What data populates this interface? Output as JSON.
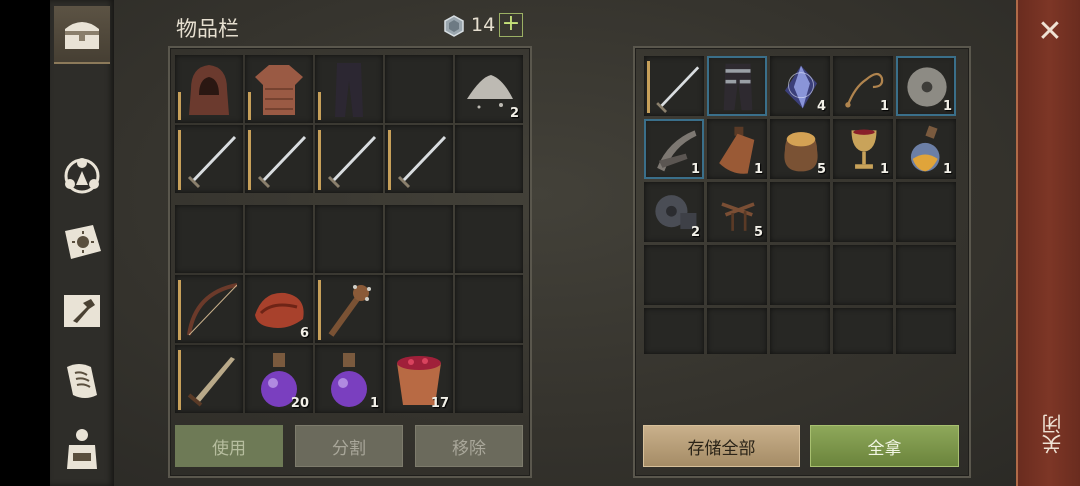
{
  "header": {
    "title": "物品栏",
    "currency_icon": "gem-icon",
    "currency_count": "14",
    "add_currency": "+"
  },
  "inventory": {
    "equipped": [
      {
        "icon": "hood-icon"
      },
      {
        "icon": "tunic-icon"
      },
      {
        "icon": "pants-icon"
      },
      {
        "icon": ""
      },
      {
        "icon": "ash-pile-icon",
        "qty": "2"
      },
      {
        "icon": "sword-icon"
      },
      {
        "icon": "sword-icon"
      },
      {
        "icon": "sword-icon"
      },
      {
        "icon": "sword-icon"
      },
      {
        "icon": ""
      }
    ],
    "bag": [
      {
        "icon": ""
      },
      {
        "icon": ""
      },
      {
        "icon": ""
      },
      {
        "icon": ""
      },
      {
        "icon": ""
      },
      {
        "icon": "bow-icon"
      },
      {
        "icon": "meat-icon",
        "qty": "6"
      },
      {
        "icon": "spiked-club-icon"
      },
      {
        "icon": ""
      },
      {
        "icon": ""
      },
      {
        "icon": "short-sword-icon"
      },
      {
        "icon": "purple-potion-icon",
        "qty": "20"
      },
      {
        "icon": "purple-potion-icon",
        "qty": "1"
      },
      {
        "icon": "berry-bucket-icon",
        "qty": "17"
      },
      {
        "icon": ""
      }
    ],
    "buttons": {
      "use": "使用",
      "split": "分割",
      "remove": "移除"
    }
  },
  "storage": {
    "items": [
      {
        "icon": "sword-icon"
      },
      {
        "icon": "leg-armor-icon"
      },
      {
        "icon": "crystal-icon",
        "qty": "4"
      },
      {
        "icon": "rope-icon",
        "qty": "1"
      },
      {
        "icon": "millstone-icon",
        "qty": "1"
      },
      {
        "icon": "crossbow-part-icon",
        "qty": "1"
      },
      {
        "icon": "leather-bottle-icon",
        "qty": "1"
      },
      {
        "icon": "grain-sack-icon",
        "qty": "5"
      },
      {
        "icon": "goblet-icon",
        "qty": "1"
      },
      {
        "icon": "orange-potion-icon",
        "qty": "1"
      },
      {
        "icon": "gear-part-icon",
        "qty": "2"
      },
      {
        "icon": "nails-icon",
        "qty": "5"
      },
      {
        "icon": ""
      },
      {
        "icon": ""
      },
      {
        "icon": ""
      },
      {
        "icon": ""
      },
      {
        "icon": ""
      },
      {
        "icon": ""
      },
      {
        "icon": ""
      },
      {
        "icon": ""
      },
      {
        "icon": ""
      },
      {
        "icon": ""
      },
      {
        "icon": ""
      },
      {
        "icon": ""
      },
      {
        "icon": ""
      }
    ],
    "buttons": {
      "store_all": "存储全部",
      "take_all": "全拿"
    }
  },
  "close": {
    "icon": "close-icon",
    "label": "关闭"
  },
  "colors": {
    "accent_green": "#8ea85a",
    "close_bar": "#7d3626"
  }
}
